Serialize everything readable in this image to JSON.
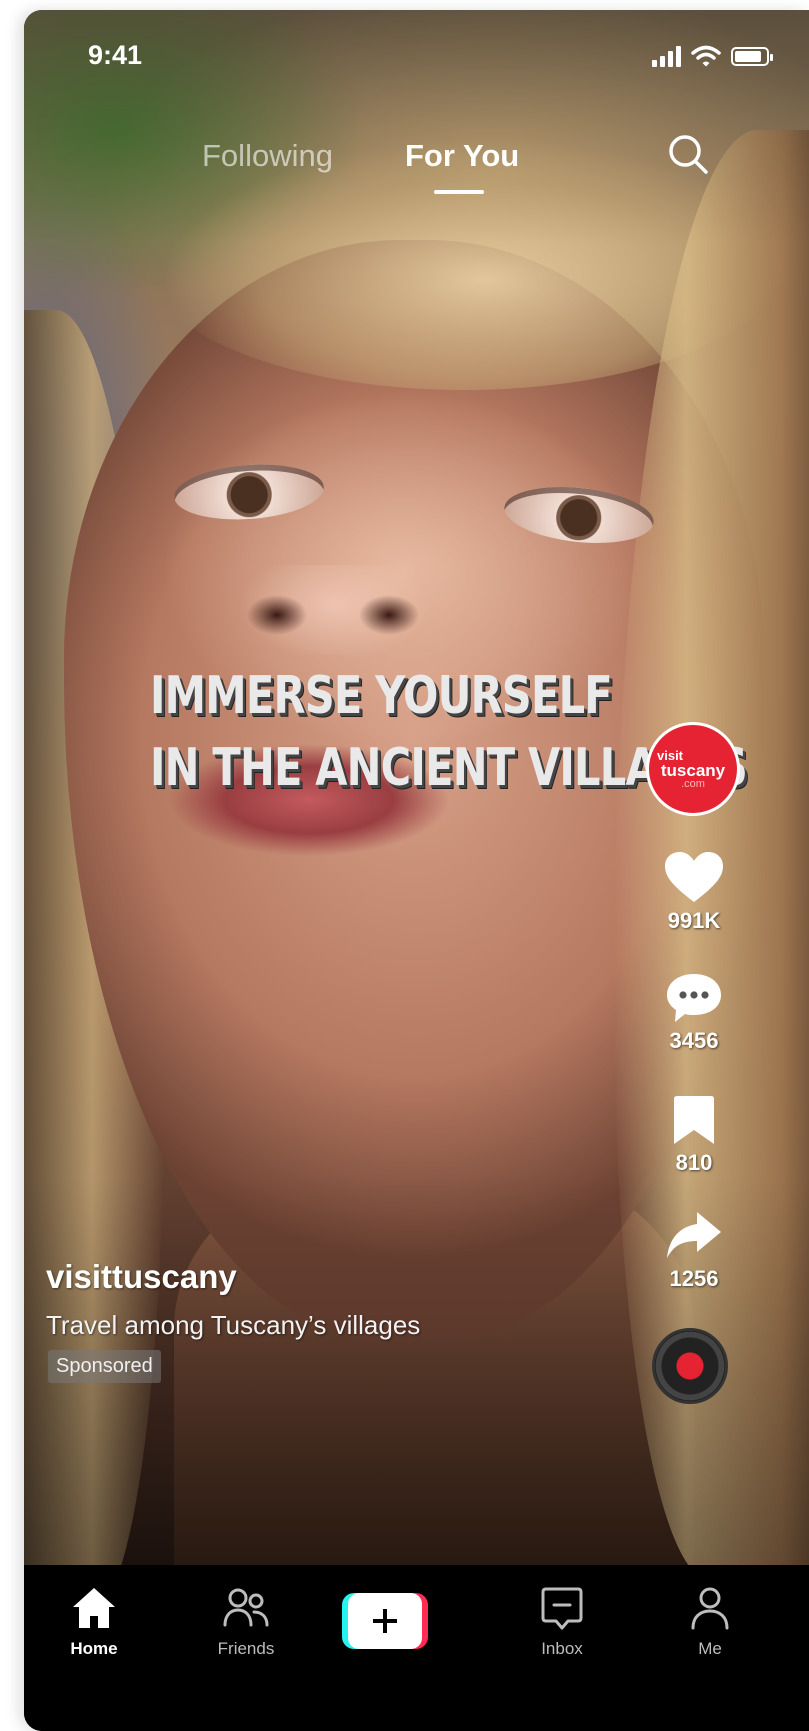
{
  "status_bar": {
    "time": "9:41",
    "battery_level": 0.85,
    "icons": [
      "cellular-signal-icon",
      "wifi-icon",
      "battery-icon"
    ]
  },
  "top_tabs": {
    "following": "Following",
    "for_you": "For You",
    "active": "For You",
    "search_icon": "search-icon"
  },
  "video": {
    "overlay_line1": "IMMERSE YOURSELF",
    "overlay_line2": "IN THE ANCIENT VILLAGES"
  },
  "creator_avatar": {
    "line1": "visit",
    "line2": "tuscany",
    "line3": ".com",
    "color": "#e62333"
  },
  "actions": {
    "like_count": "991K",
    "comment_count": "3456",
    "save_count": "810",
    "share_count": "1256",
    "icons": [
      "heart-icon",
      "comment-icon",
      "bookmark-icon",
      "share-icon",
      "music-disc-icon"
    ]
  },
  "post": {
    "username": "visittuscany",
    "caption": "Travel among Tuscany’s villages",
    "badge": "Sponsored"
  },
  "bottom_nav": {
    "home": "Home",
    "friends": "Friends",
    "inbox": "Inbox",
    "me": "Me",
    "active": "Home",
    "create_icon": "plus-icon"
  },
  "colors": {
    "brand_cyan": "#25f4ee",
    "brand_pink": "#fe2c55",
    "nav_background": "#000000"
  }
}
